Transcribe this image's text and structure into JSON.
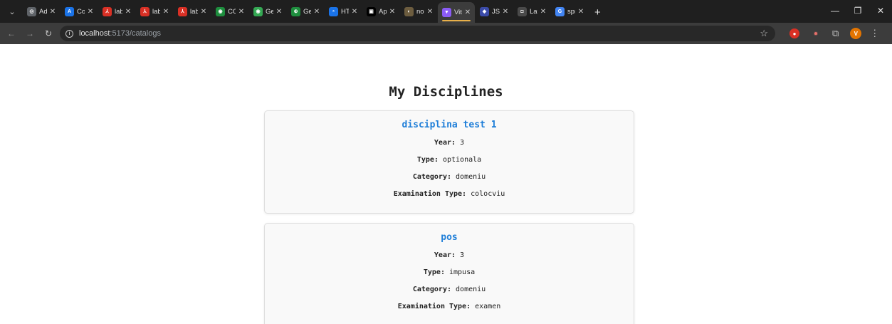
{
  "browser": {
    "tabs": [
      {
        "title": "Adresa",
        "fav_color": "#5f6368",
        "fav_glyph": "◎",
        "active": false
      },
      {
        "title": "Course",
        "fav_color": "#1a73e8",
        "fav_glyph": "A",
        "active": false
      },
      {
        "title": "laborat",
        "fav_color": "#d93025",
        "fav_glyph": "⅄",
        "active": false
      },
      {
        "title": "laborat",
        "fav_color": "#d93025",
        "fav_glyph": "⅄",
        "active": false
      },
      {
        "title": "laborat",
        "fav_color": "#d93025",
        "fav_glyph": "⅄",
        "active": false
      },
      {
        "title": "CORS (",
        "fav_color": "#1e8e3e",
        "fav_glyph": "◉",
        "active": false
      },
      {
        "title": "Getting",
        "fav_color": "#34a853",
        "fav_glyph": "◉",
        "active": false
      },
      {
        "title": "Getting",
        "fav_color": "#1e8e3e",
        "fav_glyph": "⊕",
        "active": false
      },
      {
        "title": "HTML",
        "fav_color": "#1a73e8",
        "fav_glyph": "◓",
        "active": false
      },
      {
        "title": "App.js",
        "fav_color": "#000000",
        "fav_glyph": "▣",
        "active": false
      },
      {
        "title": "node.js",
        "fav_color": "#6d5d3f",
        "fav_glyph": "◐",
        "active": false
      },
      {
        "title": "Vite +",
        "fav_color": "#8b5cf6",
        "fav_glyph": "▼",
        "active": true
      },
      {
        "title": "JSON V",
        "fav_color": "#3b4ba8",
        "fav_glyph": "◆",
        "active": false
      },
      {
        "title": "Latest",
        "fav_color": "#4a4a4a",
        "fav_glyph": "◘",
        "active": false
      },
      {
        "title": "spring",
        "fav_color": "#4285f4",
        "fav_glyph": "G",
        "active": false
      }
    ],
    "address": {
      "host": "localhost",
      "path": ":5173/catalogs"
    }
  },
  "page": {
    "title": "My Disciplines",
    "labels": {
      "year": "Year:",
      "type": "Type:",
      "category": "Category:",
      "exam": "Examination Type:"
    },
    "disciplines": [
      {
        "name": "disciplina test 1",
        "year": "3",
        "type": "optionala",
        "category": "domeniu",
        "exam": "colocviu"
      },
      {
        "name": "pos",
        "year": "3",
        "type": "impusa",
        "category": "domeniu",
        "exam": "examen"
      }
    ]
  }
}
